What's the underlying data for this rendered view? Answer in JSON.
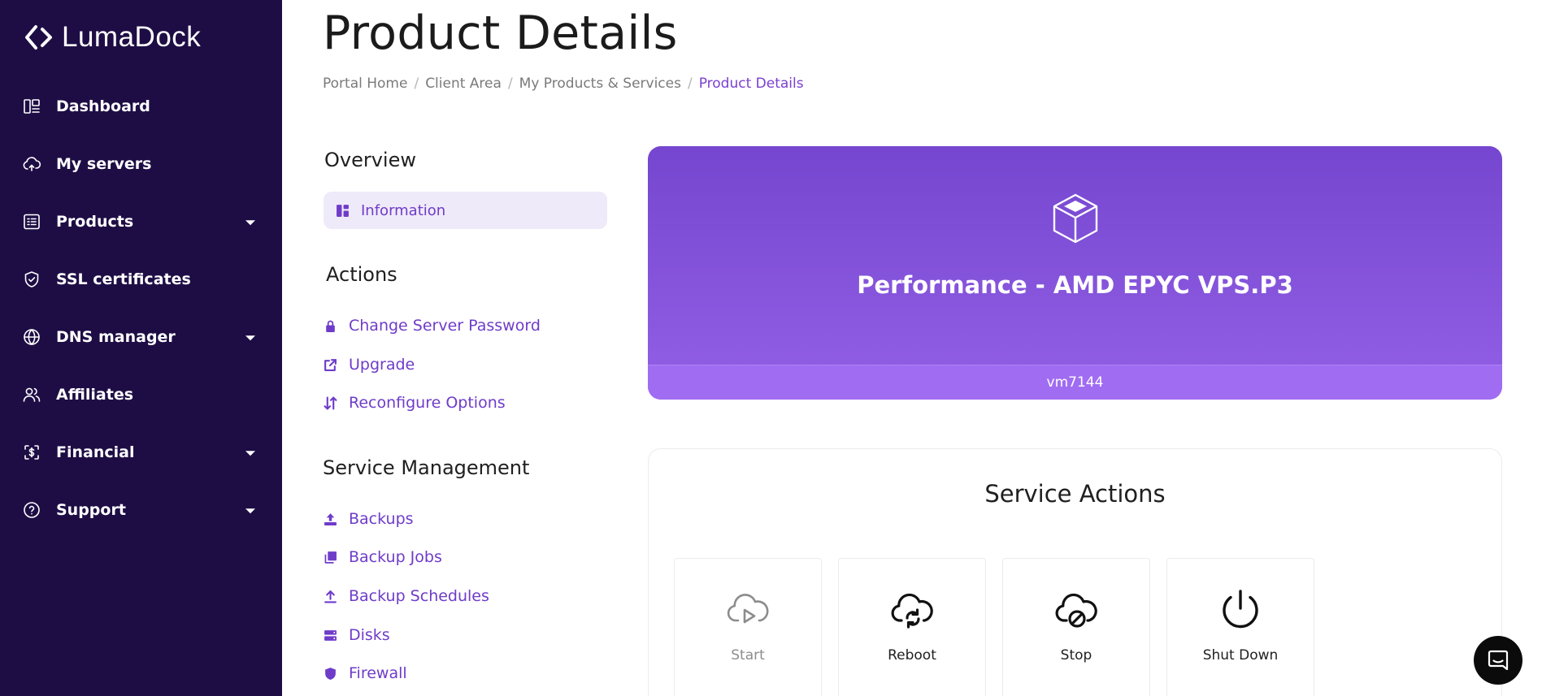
{
  "brand": {
    "name": "LumaDock"
  },
  "sidebar": {
    "items": [
      {
        "label": "Dashboard",
        "icon": "dashboard-icon",
        "caret": false
      },
      {
        "label": "My servers",
        "icon": "cloud-icon",
        "caret": false
      },
      {
        "label": "Products",
        "icon": "products-list-icon",
        "caret": true
      },
      {
        "label": "SSL certificates",
        "icon": "shield-icon",
        "caret": false
      },
      {
        "label": "DNS manager",
        "icon": "globe-icon",
        "caret": true
      },
      {
        "label": "Affiliates",
        "icon": "users-icon",
        "caret": false
      },
      {
        "label": "Financial",
        "icon": "dollar-icon",
        "caret": true
      },
      {
        "label": "Support",
        "icon": "help-icon",
        "caret": true
      }
    ]
  },
  "page": {
    "title": "Product Details"
  },
  "breadcrumb": {
    "items": [
      "Portal Home",
      "Client Area",
      "My Products & Services"
    ],
    "active": "Product Details"
  },
  "overview": {
    "heading": "Overview",
    "information_label": "Information"
  },
  "actions": {
    "heading": "Actions",
    "links": [
      "Change Server Password",
      "Upgrade",
      "Reconfigure Options"
    ]
  },
  "service_management": {
    "heading": "Service Management",
    "links": [
      "Backups",
      "Backup Jobs",
      "Backup Schedules",
      "Disks",
      "Firewall"
    ]
  },
  "product": {
    "name": "Performance - AMD EPYC VPS.P3",
    "hostname": "vm7144"
  },
  "service_actions": {
    "title": "Service Actions",
    "buttons": [
      {
        "label": "Start",
        "enabled": false
      },
      {
        "label": "Reboot",
        "enabled": true
      },
      {
        "label": "Stop",
        "enabled": true
      },
      {
        "label": "Shut Down",
        "enabled": true
      }
    ]
  },
  "colors": {
    "sidebar_bg": "#1e0d45",
    "accent": "#6f3cc9",
    "card_gradient_top": "#7546cf",
    "card_gradient_bottom": "#9360e6"
  }
}
